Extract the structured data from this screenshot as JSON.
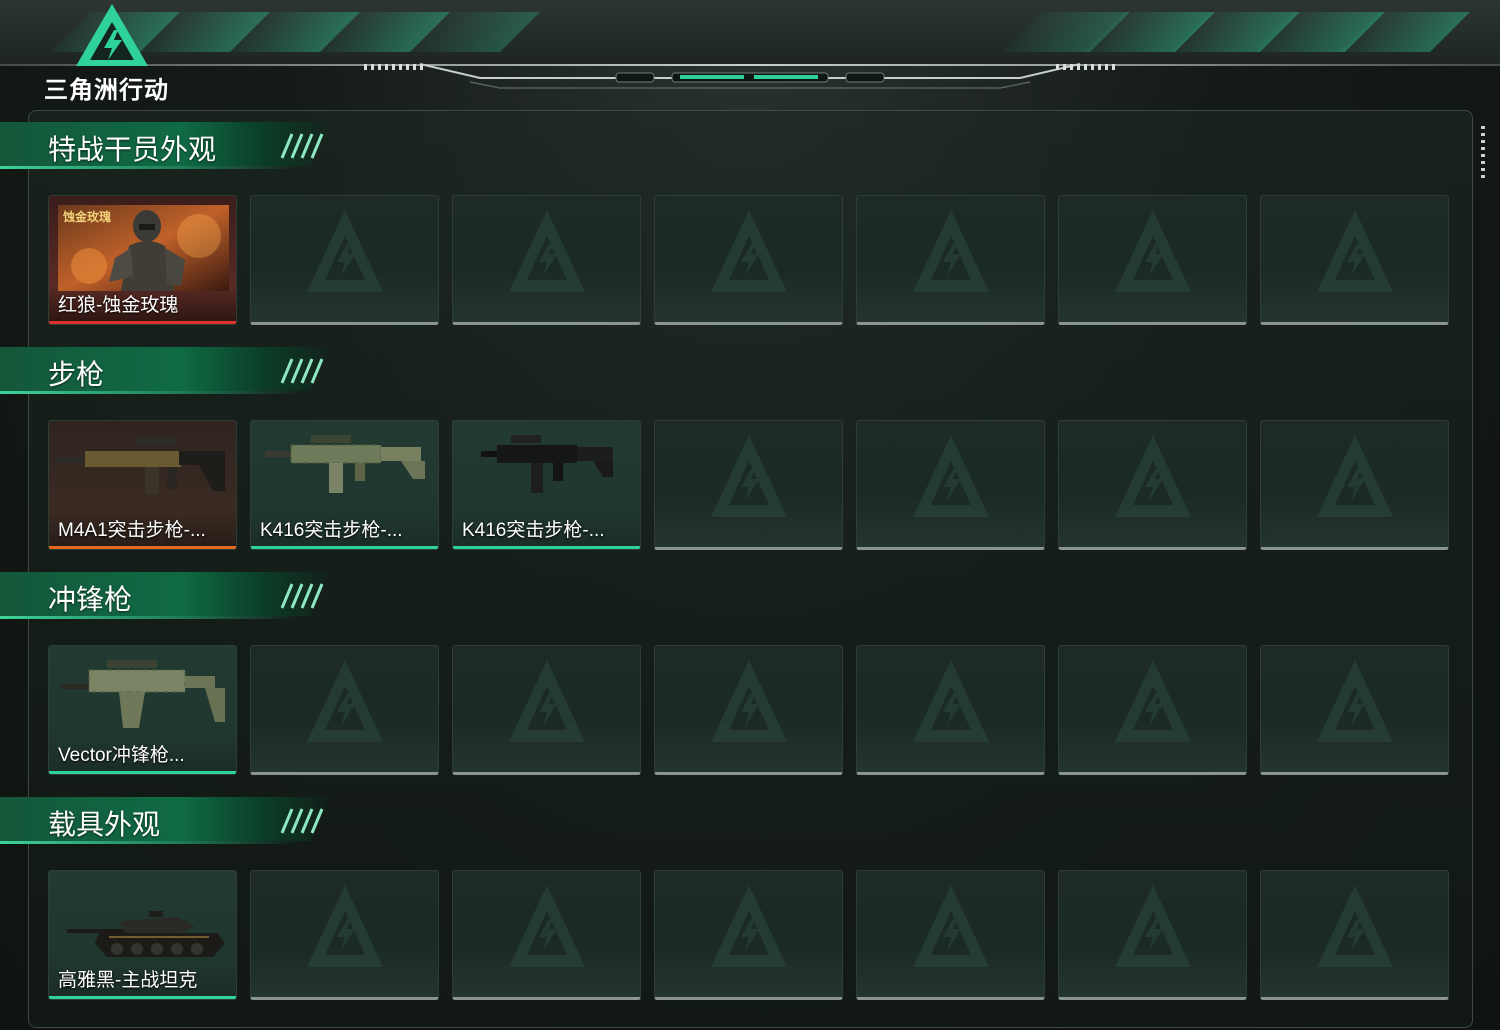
{
  "app": {
    "logo_text": "三角洲行动"
  },
  "colors": {
    "accent": "#2fd29a",
    "rarity_red": "#e0302d",
    "rarity_orange": "#e26a1e",
    "rarity_green": "#2fd29a",
    "empty_bar": "#8b9590"
  },
  "sections": [
    {
      "title": "特战干员外观",
      "items": [
        {
          "name": "红狼-蚀金玫瑰",
          "rarity": "red",
          "art_label": "蚀金玫瑰",
          "icon": "operator-portrait-icon"
        }
      ]
    },
    {
      "title": "步枪",
      "items": [
        {
          "name": "M4A1突击步枪-...",
          "rarity": "orange",
          "icon": "rifle-icon"
        },
        {
          "name": "K416突击步枪-...",
          "rarity": "green",
          "icon": "rifle-icon"
        },
        {
          "name": "K416突击步枪-...",
          "rarity": "green",
          "icon": "rifle-icon"
        }
      ]
    },
    {
      "title": "冲锋枪",
      "items": [
        {
          "name": "Vector冲锋枪...",
          "rarity": "green",
          "icon": "smg-icon"
        }
      ]
    },
    {
      "title": "载具外观",
      "items": [
        {
          "name": "高雅黑-主战坦克",
          "rarity": "green",
          "icon": "tank-icon"
        }
      ]
    }
  ],
  "slots_per_row": 7
}
